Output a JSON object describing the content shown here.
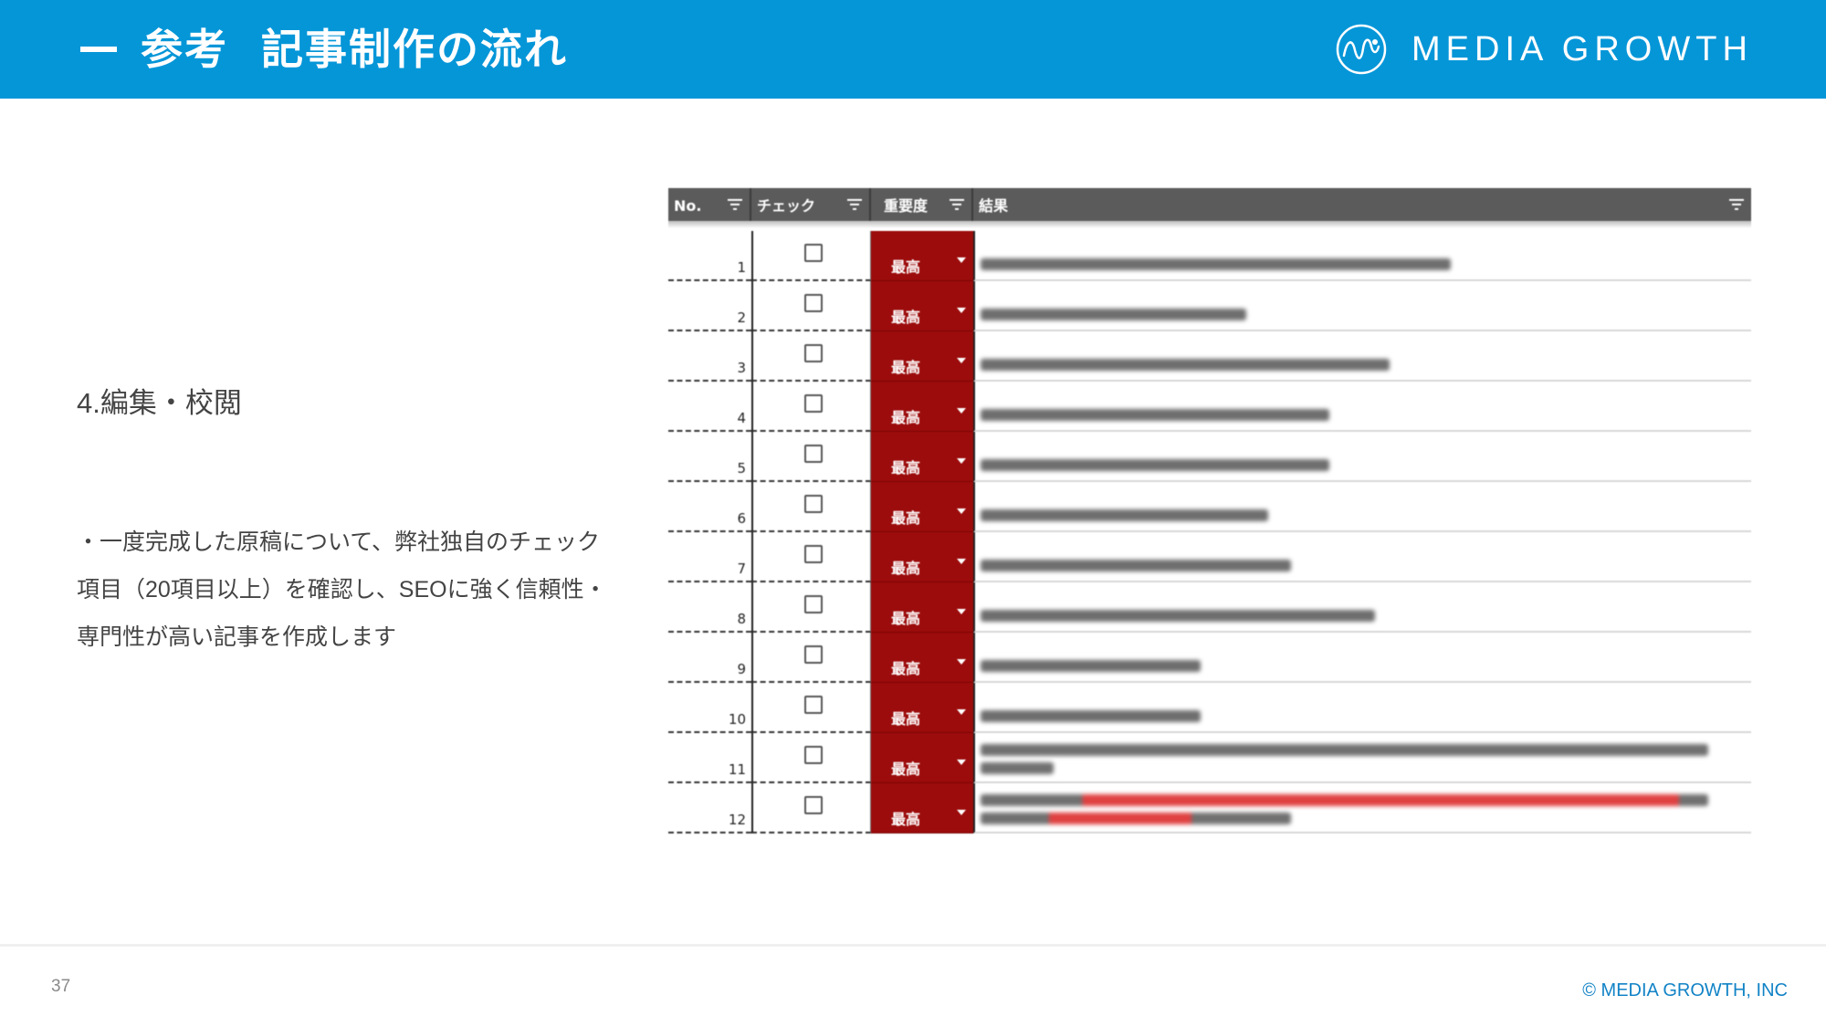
{
  "header": {
    "title_prefix": "参考",
    "title_main": "記事制作の流れ",
    "brand": "MEDIA GROWTH",
    "background": "#0596d8"
  },
  "section": {
    "title": "4.編集・校閲",
    "description_lines": [
      "・一度完成した原稿について、弊社独自のチェック",
      "項目（20項目以上）を確認し、SEOに強く信頼性・",
      "専門性が高い記事を作成します"
    ]
  },
  "checklist": {
    "columns": [
      "No.",
      "チェック",
      "重要度",
      "結果"
    ],
    "importance_color": "#9c0c0c",
    "rows": [
      {
        "no": "1",
        "importance": "最高",
        "result_width": 0.62
      },
      {
        "no": "2",
        "importance": "最高",
        "result_width": 0.35
      },
      {
        "no": "3",
        "importance": "最高",
        "result_width": 0.54
      },
      {
        "no": "4",
        "importance": "最高",
        "result_width": 0.46
      },
      {
        "no": "5",
        "importance": "最高",
        "result_width": 0.46
      },
      {
        "no": "6",
        "importance": "最高",
        "result_width": 0.38
      },
      {
        "no": "7",
        "importance": "最高",
        "result_width": 0.41
      },
      {
        "no": "8",
        "importance": "最高",
        "result_width": 0.52
      },
      {
        "no": "9",
        "importance": "最高",
        "result_width": 0.29
      },
      {
        "no": "10",
        "importance": "最高",
        "result_width": 0.29
      },
      {
        "no": "11",
        "importance": "最高",
        "result_width": 0.96
      },
      {
        "no": "12",
        "importance": "最高",
        "result_width": 0.96
      }
    ]
  },
  "footer": {
    "page_number": "37",
    "copyright": "© MEDIA GROWTH, INC"
  }
}
